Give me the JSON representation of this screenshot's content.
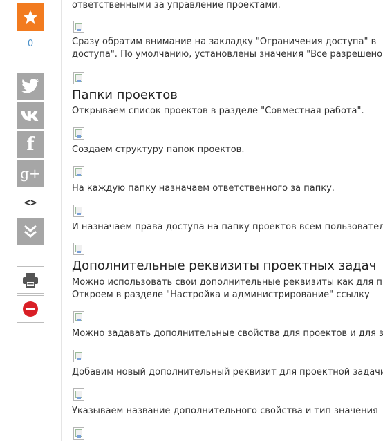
{
  "sidebar": {
    "like_count": "0",
    "icons": {
      "favorite": "star-icon",
      "twitter": "twitter-icon",
      "vk": "vk-icon",
      "facebook": "facebook-icon",
      "googleplus": "google-plus-icon",
      "embed": "code-icon",
      "more": "double-chevron-down-icon",
      "print": "printer-icon",
      "block": "no-entry-icon"
    },
    "facebook_glyph": "f",
    "googleplus_glyph": "g+",
    "embed_glyph": "<>"
  },
  "colors": {
    "accent": "#f27b1f",
    "social_grey": "#a6a6a6",
    "link_blue": "#4a90c8",
    "danger": "#d91f26"
  },
  "content": {
    "line_top": "ответственными за управление проектами.",
    "line_tab_1": "Сразу обратим внимание на закладку \"Ограничения доступа\" в",
    "line_tab_2": "доступа\". По умолчанию, установлены значения \"Все разрешено\"",
    "heading_folders": "Папки проектов",
    "line_open_list": "Открываем список проектов в разделе \"Совместная работа\".",
    "line_structure": "Создаем структуру папок проектов.",
    "line_responsible": "На каждую папку назначаем ответственного за папку.",
    "line_rights": "И назначаем права доступа на папку проектов всем пользователям",
    "heading_props": "Дополнительные реквизиты проектных задач",
    "line_own_props": "Можно использовать свои дополнительные реквизиты как для проектов",
    "line_open_section": "Откроем в разделе \"Настройка и администрирование\" ссылку",
    "line_set_props": "Можно задавать дополнительные свойства для проектов и для задач",
    "line_add_prop": "Добавим новый дополнительный реквизит для проектной задачи",
    "line_name_type": "Указываем название дополнительного свойства и тип значения"
  }
}
